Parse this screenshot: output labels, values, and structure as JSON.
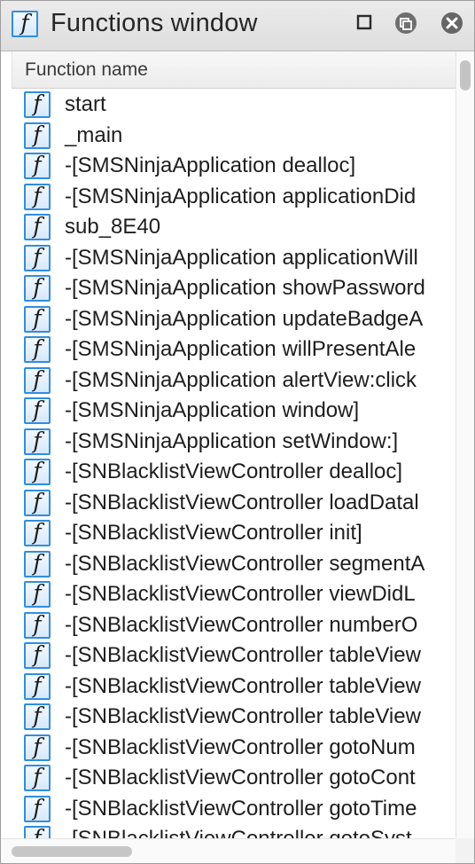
{
  "window": {
    "title": "Functions window",
    "title_icon": "function-icon",
    "buttons": [
      {
        "name": "maximize",
        "icon": "square-outline-icon"
      },
      {
        "name": "float",
        "icon": "float-window-icon"
      },
      {
        "name": "close",
        "icon": "close-circle-icon"
      }
    ]
  },
  "list": {
    "column_header": "Function name",
    "rows": [
      "start",
      "_main",
      "-[SMSNinjaApplication dealloc]",
      "-[SMSNinjaApplication applicationDid",
      "sub_8E40",
      "-[SMSNinjaApplication applicationWill",
      "-[SMSNinjaApplication showPassword",
      "-[SMSNinjaApplication updateBadgeA",
      "-[SMSNinjaApplication willPresentAle",
      "-[SMSNinjaApplication alertView:click",
      "-[SMSNinjaApplication window]",
      "-[SMSNinjaApplication setWindow:]",
      "-[SNBlacklistViewController dealloc]",
      "-[SNBlacklistViewController loadDatal",
      "-[SNBlacklistViewController init]",
      "-[SNBlacklistViewController segmentA",
      "-[SNBlacklistViewController viewDidL",
      "-[SNBlacklistViewController numberO",
      "-[SNBlacklistViewController tableView",
      "-[SNBlacklistViewController tableView",
      "-[SNBlacklistViewController tableView",
      "-[SNBlacklistViewController gotoNum",
      "-[SNBlacklistViewController gotoCont",
      "-[SNBlacklistViewController gotoTime",
      "-[SNBlacklistViewController gotoSyst"
    ]
  },
  "colors": {
    "icon_border": "#2f8ee0",
    "titlebar_bg": "#e4e4e4",
    "text": "#1e1e1e"
  }
}
